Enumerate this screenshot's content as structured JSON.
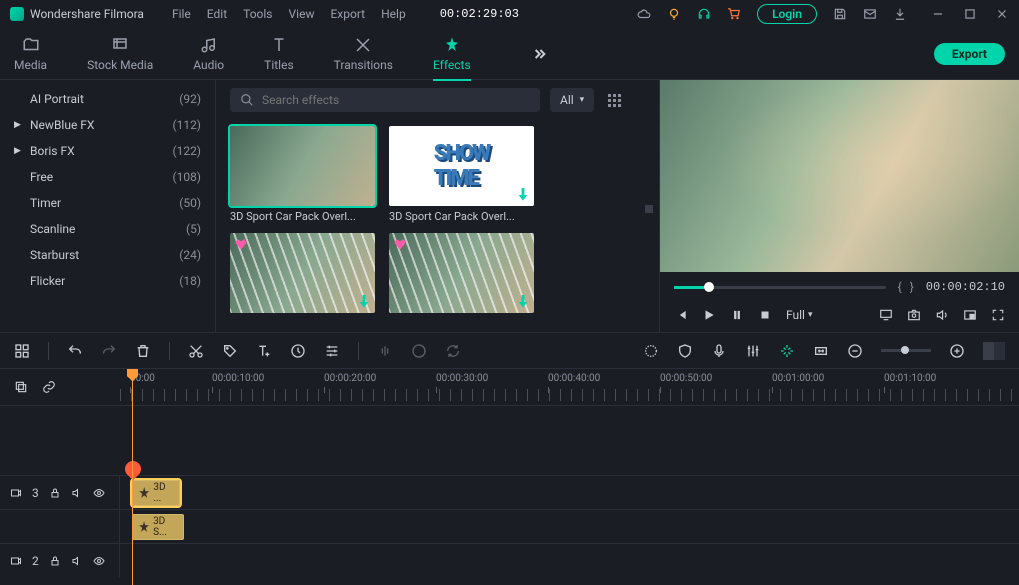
{
  "app": {
    "name": "Wondershare Filmora"
  },
  "menu": [
    "File",
    "Edit",
    "Tools",
    "View",
    "Export",
    "Help"
  ],
  "titlebar_timecode": "00:02:29:03",
  "login_label": "Login",
  "tabs": [
    {
      "id": "media",
      "label": "Media"
    },
    {
      "id": "stock",
      "label": "Stock Media"
    },
    {
      "id": "audio",
      "label": "Audio"
    },
    {
      "id": "titles",
      "label": "Titles"
    },
    {
      "id": "transitions",
      "label": "Transitions"
    },
    {
      "id": "effects",
      "label": "Effects",
      "active": true
    }
  ],
  "export_label": "Export",
  "categories": [
    {
      "label": "AI Portrait",
      "count": "(92)"
    },
    {
      "label": "NewBlue FX",
      "count": "(112)",
      "expandable": true
    },
    {
      "label": "Boris FX",
      "count": "(122)",
      "expandable": true
    },
    {
      "label": "Free",
      "count": "(108)"
    },
    {
      "label": "Timer",
      "count": "(50)"
    },
    {
      "label": "Scanline",
      "count": "(5)"
    },
    {
      "label": "Starburst",
      "count": "(24)"
    },
    {
      "label": "Flicker",
      "count": "(18)"
    }
  ],
  "search_placeholder": "Search effects",
  "filter_selected": "All",
  "effects": [
    {
      "label": "3D Sport Car Pack Overl...",
      "selected": true
    },
    {
      "label": "3D Sport Car Pack Overl..."
    },
    {
      "label": ""
    },
    {
      "label": ""
    }
  ],
  "preview": {
    "timecode": "00:00:02:10",
    "quality": "Full"
  },
  "ruler_marks": [
    "00:00",
    "00:00:10:00",
    "00:00:20:00",
    "00:00:30:00",
    "00:00:40:00",
    "00:00:50:00",
    "00:01:00:00",
    "00:01:10:00"
  ],
  "tracks": {
    "t3": {
      "num": "3",
      "clip_label": "3D ..."
    },
    "t2": {
      "num": "2",
      "clip_label": "3D S..."
    }
  }
}
